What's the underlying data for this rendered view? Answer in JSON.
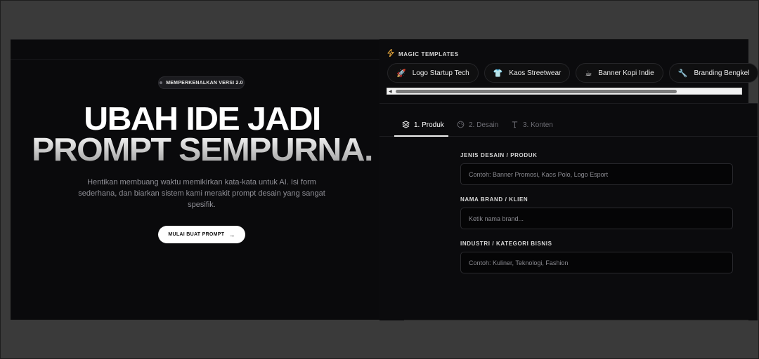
{
  "hero": {
    "badge": "MEMPERKENALKAN VERSI 2.0",
    "title_line1": "UBAH IDE JADI",
    "title_line2": "PROMPT SEMPURNA.",
    "description": "Hentikan membuang waktu memikirkan kata-kata untuk AI. Isi form sederhana, dan biarkan sistem kami merakit prompt desain yang sangat spesifik.",
    "cta_label": "MULAI BUAT PROMPT",
    "cta_icon": "arrow-right-icon"
  },
  "magic_templates": {
    "title": "MAGIC TEMPLATES",
    "icon": "bolt-icon",
    "chips": [
      {
        "label": "Logo Startup Tech",
        "icon": "rocket-icon"
      },
      {
        "label": "Kaos Streetwear",
        "icon": "tshirt-icon"
      },
      {
        "label": "Banner Kopi Indie",
        "icon": "coffee-icon"
      },
      {
        "label": "Branding Bengkel",
        "icon": "wrench-icon"
      }
    ]
  },
  "tabs": [
    {
      "label": "1. Produk",
      "icon": "layers-icon",
      "active": true
    },
    {
      "label": "2. Desain",
      "icon": "palette-icon",
      "active": false
    },
    {
      "label": "3. Konten",
      "icon": "text-icon",
      "active": false
    }
  ],
  "form": {
    "fields": [
      {
        "label": "JENIS DESAIN / PRODUK",
        "placeholder": "Contoh: Banner Promosi, Kaos Polo, Logo Esport",
        "value": ""
      },
      {
        "label": "NAMA BRAND / KLIEN",
        "placeholder": "Ketik nama brand...",
        "value": ""
      },
      {
        "label": "INDUSTRI / KATEGORI BISNIS",
        "placeholder": "Contoh: Kuliner, Teknologi, Fashion",
        "value": ""
      }
    ]
  },
  "colors": {
    "background": "#0a0a0c",
    "accent_bolt": "#e0a23a",
    "text_primary": "#ffffff",
    "text_muted": "#8f8f96"
  }
}
